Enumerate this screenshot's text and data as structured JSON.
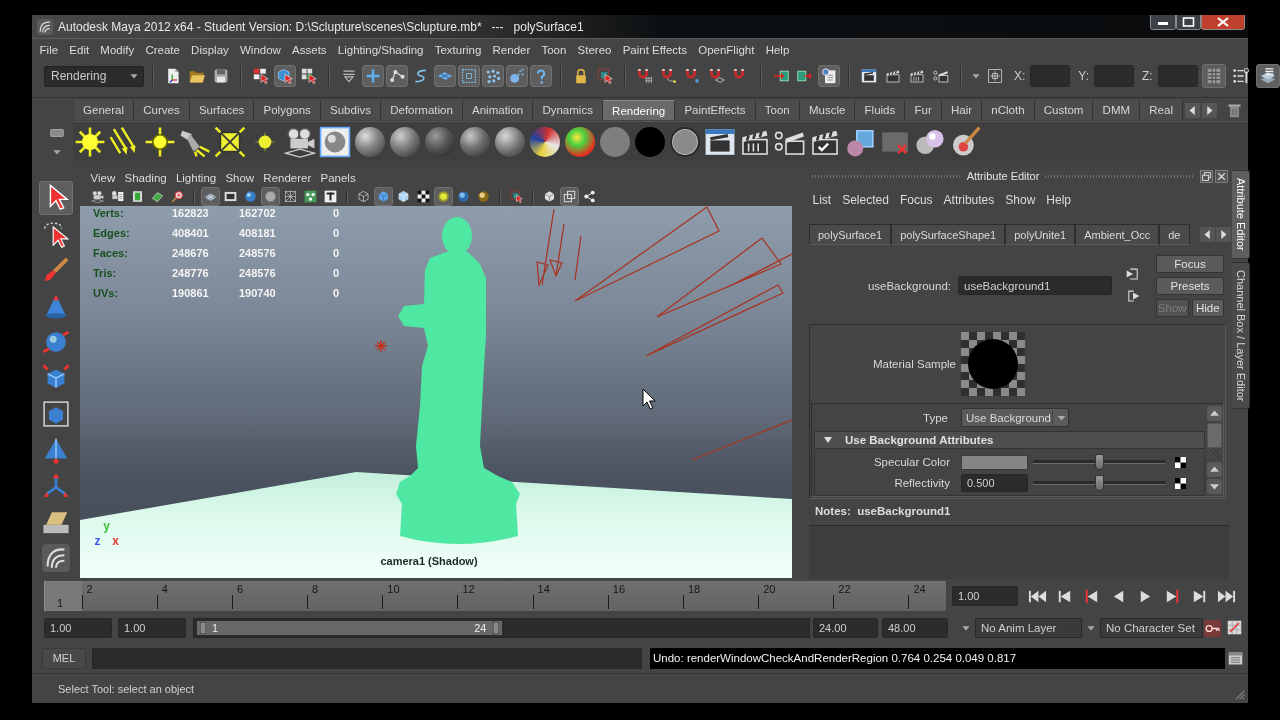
{
  "window": {
    "title": "Autodesk Maya 2012 x64 - Student Version: D:\\Sclupture\\scenes\\Sclupture.mb*   ---   polySurface1"
  },
  "menu_bar": [
    "File",
    "Edit",
    "Modify",
    "Create",
    "Display",
    "Window",
    "Assets",
    "Lighting/Shading",
    "Texturing",
    "Render",
    "Toon",
    "Stereo",
    "Paint Effects",
    "OpenFlight",
    "Help"
  ],
  "status_line": {
    "menu_set": "Rendering",
    "tools": [
      {
        "on": false
      },
      {
        "on": false
      },
      {
        "on": false
      },
      {
        "on": false
      },
      {
        "on": true
      },
      {
        "on": false
      },
      {
        "on": false
      },
      {
        "on": true
      },
      {
        "on": true
      },
      {
        "on": false
      },
      {
        "on": true
      },
      {
        "on": true
      },
      {
        "on": true
      },
      {
        "on": true
      },
      {
        "on": true
      },
      {
        "on": false
      },
      {
        "on": false
      },
      {
        "on": false
      },
      {
        "on": false
      },
      {
        "on": false
      },
      {
        "on": false
      },
      {
        "on": false
      },
      {
        "on": false
      },
      {
        "on": false
      },
      {
        "on": true
      },
      {
        "on": false
      },
      {
        "on": false
      },
      {
        "on": false
      },
      {
        "on": false
      },
      {
        "on": false
      }
    ],
    "coordinate_fields": [
      {
        "label": "X:"
      },
      {
        "label": "Y:"
      },
      {
        "label": "Z:"
      }
    ],
    "panel_toggles": [
      {
        "on": true
      },
      {
        "on": false
      },
      {
        "on": true
      }
    ]
  },
  "shelf": {
    "tabs": [
      {
        "label": "General",
        "selected": false
      },
      {
        "label": "Curves",
        "selected": false
      },
      {
        "label": "Surfaces",
        "selected": false
      },
      {
        "label": "Polygons",
        "selected": false
      },
      {
        "label": "Subdivs",
        "selected": false
      },
      {
        "label": "Deformation",
        "selected": false
      },
      {
        "label": "Animation",
        "selected": false
      },
      {
        "label": "Dynamics",
        "selected": false
      },
      {
        "label": "Rendering",
        "selected": true
      },
      {
        "label": "PaintEffects",
        "selected": false
      },
      {
        "label": "Toon",
        "selected": false
      },
      {
        "label": "Muscle",
        "selected": false
      },
      {
        "label": "Fluids",
        "selected": false
      },
      {
        "label": "Fur",
        "selected": false
      },
      {
        "label": "Hair",
        "selected": false
      },
      {
        "label": "nCloth",
        "selected": false
      },
      {
        "label": "Custom",
        "selected": false
      },
      {
        "label": "DMM",
        "selected": false
      },
      {
        "label": "Real",
        "selected": false
      }
    ]
  },
  "toolbox": [
    {
      "on": true
    },
    {
      "on": false
    },
    {
      "on": false
    },
    {
      "on": false
    },
    {
      "on": false
    },
    {
      "on": false
    },
    {
      "on": false
    },
    {
      "on": false
    },
    {
      "on": false
    },
    {
      "on": false
    },
    {
      "on": false
    }
  ],
  "viewport": {
    "menu": [
      "View",
      "Shading",
      "Lighting",
      "Show",
      "Renderer",
      "Panels"
    ],
    "tools": [
      {
        "on": false
      },
      {
        "on": false
      },
      {
        "on": false
      },
      {
        "on": false
      },
      {
        "on": false
      },
      {
        "on": true
      },
      {
        "on": false
      },
      {
        "on": false
      },
      {
        "on": true
      },
      {
        "on": false
      },
      {
        "on": false
      },
      {
        "on": false
      },
      {
        "on": false
      },
      {
        "on": true
      },
      {
        "on": false
      },
      {
        "on": false
      },
      {
        "on": true
      },
      {
        "on": false
      },
      {
        "on": false
      },
      {
        "on": false
      },
      {
        "on": false
      },
      {
        "on": true
      },
      {
        "on": false
      }
    ],
    "hud": [
      {
        "label": "Verts:",
        "values": [
          "162823",
          "162702",
          "0"
        ]
      },
      {
        "label": "Edges:",
        "values": [
          "408401",
          "408181",
          "0"
        ]
      },
      {
        "label": "Faces:",
        "values": [
          "248676",
          "248576",
          "0"
        ]
      },
      {
        "label": "Tris:",
        "values": [
          "248776",
          "248576",
          "0"
        ]
      },
      {
        "label": "UVs:",
        "values": [
          "190861",
          "190740",
          "0"
        ]
      }
    ],
    "axis_labels": [
      "y",
      "z",
      "x"
    ],
    "camera_label": "camera1 (Shadow)"
  },
  "attribute_editor": {
    "title": "Attribute Editor",
    "menu": [
      "List",
      "Selected",
      "Focus",
      "Attributes",
      "Show",
      "Help"
    ],
    "node_tabs": [
      {
        "label": "polySurface1",
        "selected": false
      },
      {
        "label": "polySurfaceShape1",
        "selected": false
      },
      {
        "label": "polyUnite1",
        "selected": false
      },
      {
        "label": "Ambient_Occ",
        "selected": false
      },
      {
        "label": "de",
        "selected": false
      }
    ],
    "node_label": "useBackground:",
    "node_name": "useBackground1",
    "buttons": [
      {
        "label": "Focus",
        "disabled": false
      },
      {
        "label": "Presets",
        "disabled": false
      },
      {
        "label": "Show",
        "disabled": true
      },
      {
        "label": "Hide",
        "disabled": false
      }
    ],
    "material_sample_label": "Material Sample",
    "type": {
      "label": "Type",
      "value": "Use Background"
    },
    "section": {
      "title": "Use Background Attributes",
      "expanded": true
    },
    "attributes": [
      {
        "kind": "color",
        "label": "Specular Color",
        "color": "#858585",
        "level": 0.5
      },
      {
        "kind": "number",
        "label": "Reflectivity",
        "value": "0.500",
        "level": 0.5
      }
    ],
    "notes_label": "Notes:  useBackground1"
  },
  "side_tabs": [
    {
      "label": "Attribute Editor",
      "selected": true
    },
    {
      "label": "Channel Box / Layer Editor",
      "selected": false
    }
  ],
  "time_slider": {
    "tick_labels": [
      "2",
      "4",
      "6",
      "8",
      "10",
      "12",
      "14",
      "16",
      "18",
      "20",
      "22",
      "24"
    ],
    "level": 0,
    "current_frame": "1",
    "current_time": "1.00"
  },
  "range_slider": {
    "start_time": "1.00",
    "playback_start": "1.00",
    "range_start": "1",
    "range_end": "24",
    "level": 0.5,
    "playback_end": "24.00",
    "end_time": "48.00",
    "anim_layer": "No Anim Layer",
    "character_set": "No Character Set"
  },
  "command_line": {
    "language": "MEL",
    "result": "Undo: renderWindowCheckAndRenderRegion 0.764 0.254 0.049 0.817"
  },
  "help_line": "Select Tool: select an object"
}
